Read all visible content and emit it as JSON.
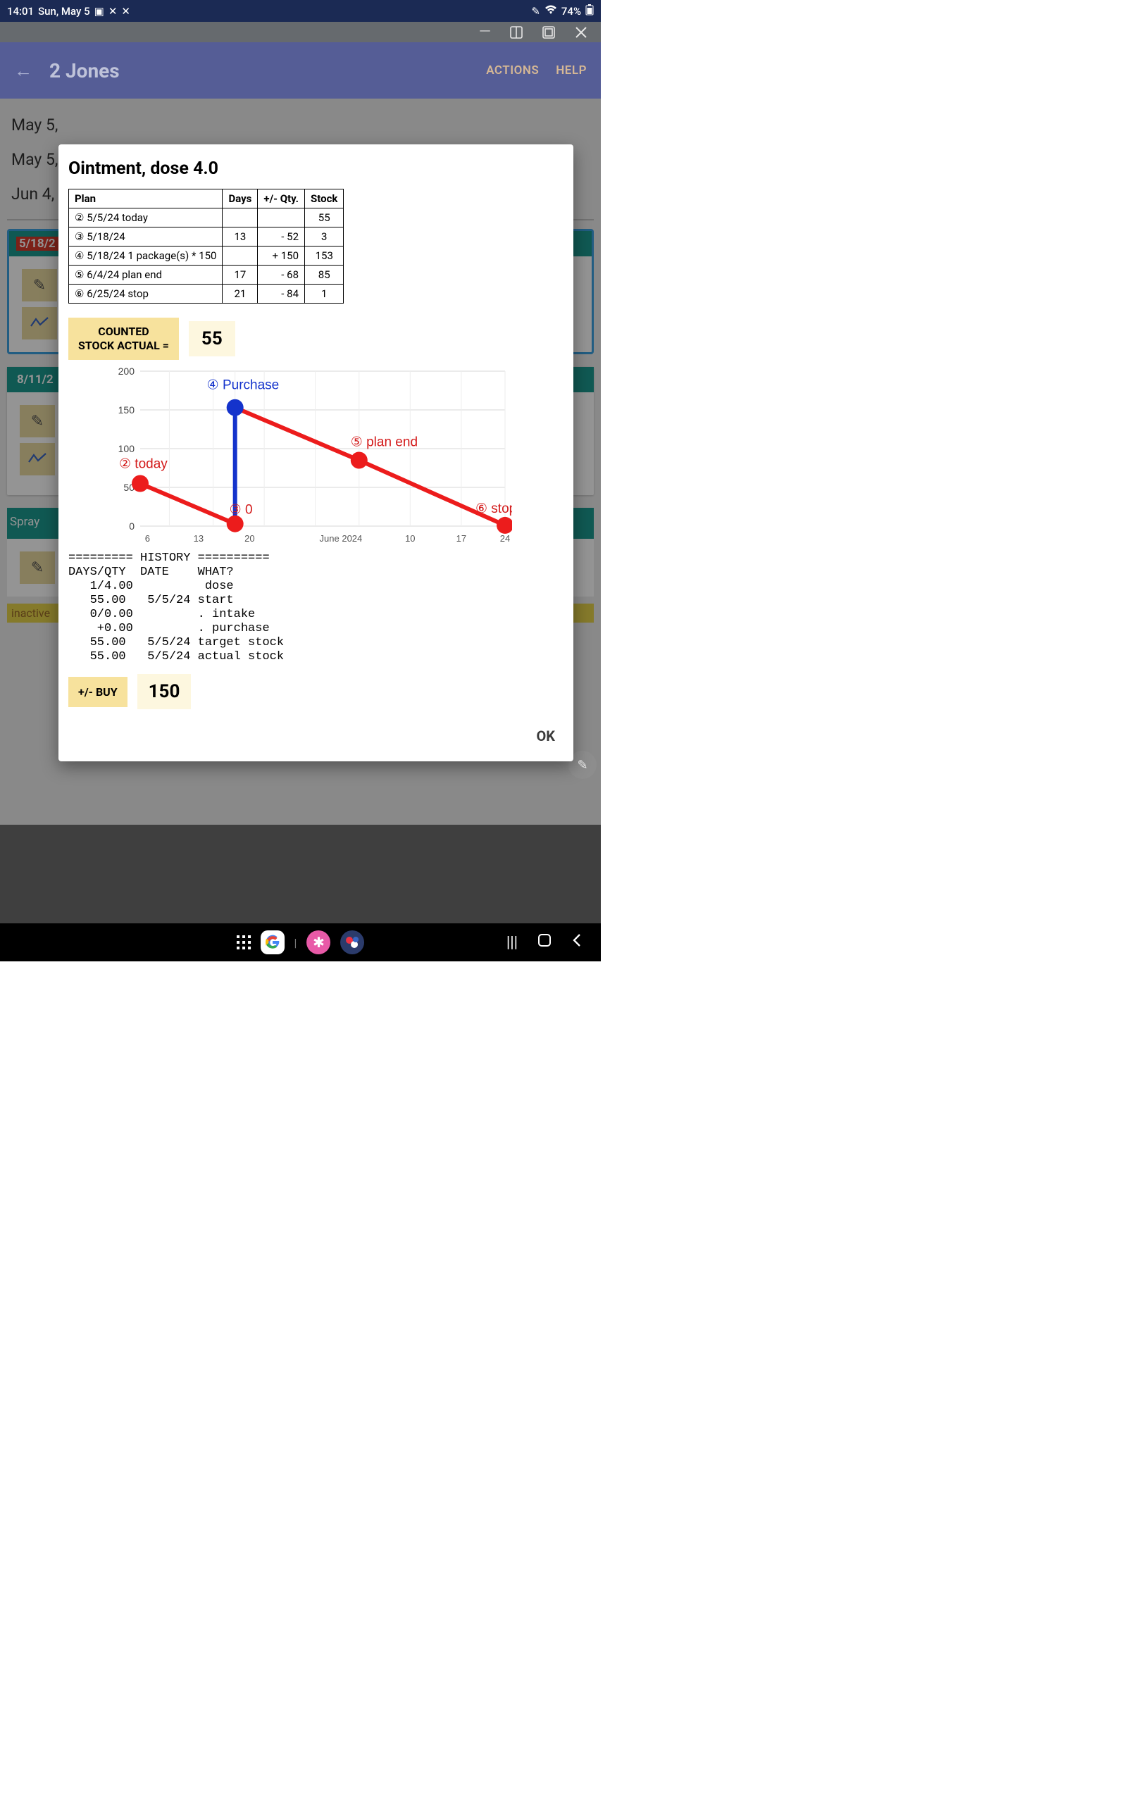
{
  "status": {
    "time": "14:01",
    "date": "Sun, May 5",
    "battery": "74%"
  },
  "winchrome": {
    "min": "—",
    "split1": "⬒",
    "split2": "◧",
    "close": "✕"
  },
  "header": {
    "back_glyph": "←",
    "title": "2 Jones",
    "actions": "ACTIONS",
    "help": "HELP"
  },
  "bg": {
    "date1": "May 5,",
    "date2": "May 5,",
    "date3": "Jun 4,",
    "badge1": "5/18/2",
    "badge2": "8/11/2",
    "spray": "Spray",
    "inactive": "inactive",
    "pencil": "✎",
    "chart": "📈"
  },
  "modal": {
    "title": "Ointment, dose 4.0",
    "table": {
      "headers": [
        "Plan",
        "Days",
        "+/- Qty.",
        "Stock"
      ],
      "rows": [
        {
          "n": "②",
          "label": "5/5/24 today",
          "days": "",
          "qty": "",
          "stock": "55"
        },
        {
          "n": "③",
          "label": "5/18/24",
          "days": "13",
          "qty": "- 52",
          "stock": "3"
        },
        {
          "n": "④",
          "label": "5/18/24 1 package(s) * 150",
          "days": "",
          "qty": "+ 150",
          "stock": "153"
        },
        {
          "n": "⑤",
          "label": "6/4/24 plan end",
          "days": "17",
          "qty": "- 68",
          "stock": "85"
        },
        {
          "n": "⑥",
          "label": "6/25/24 stop",
          "days": "21",
          "qty": "- 84",
          "stock": "1"
        }
      ]
    },
    "counted_label_l1": "COUNTED",
    "counted_label_l2": "STOCK ACTUAL =",
    "counted_value": "55",
    "buy_label": "+/- BUY",
    "buy_value": "150",
    "history": "========= HISTORY ==========\nDAYS/QTY  DATE    WHAT?\n   1/4.00          dose\n   55.00   5/5/24 start\n   0/0.00         . intake\n    +0.00         . purchase\n   55.00   5/5/24 target stock\n   55.00   5/5/24 actual stock",
    "ok": "OK"
  },
  "chart_data": {
    "type": "line",
    "title": "",
    "xlabel": "",
    "ylabel": "",
    "ylim": [
      0,
      200
    ],
    "y_ticks": [
      0,
      50,
      100,
      150,
      200
    ],
    "x_ticks": [
      "6",
      "13",
      "20",
      "June 2024",
      "10",
      "17",
      "24"
    ],
    "annotations": [
      {
        "id": "②",
        "label": "today",
        "color": "#d31919"
      },
      {
        "id": "③",
        "label": "0",
        "color": "#d31919"
      },
      {
        "id": "④",
        "label": "Purchase",
        "color": "#1433cc"
      },
      {
        "id": "⑤",
        "label": "plan end",
        "color": "#d31919"
      },
      {
        "id": "⑥",
        "label": "stop",
        "color": "#d31919"
      }
    ],
    "series": [
      {
        "name": "stock-red",
        "color": "#ec1c1c",
        "x": [
          "5/5",
          "5/18",
          "5/18+",
          "6/4",
          "6/25"
        ],
        "values": [
          55,
          3,
          153,
          85,
          1
        ]
      },
      {
        "name": "purchase-blue",
        "color": "#1433cc",
        "x": [
          "5/18",
          "5/18"
        ],
        "values": [
          3,
          153
        ]
      }
    ]
  },
  "fab": {
    "glyph": "✎"
  },
  "nav": {
    "g": "G",
    "flower": "✱"
  }
}
